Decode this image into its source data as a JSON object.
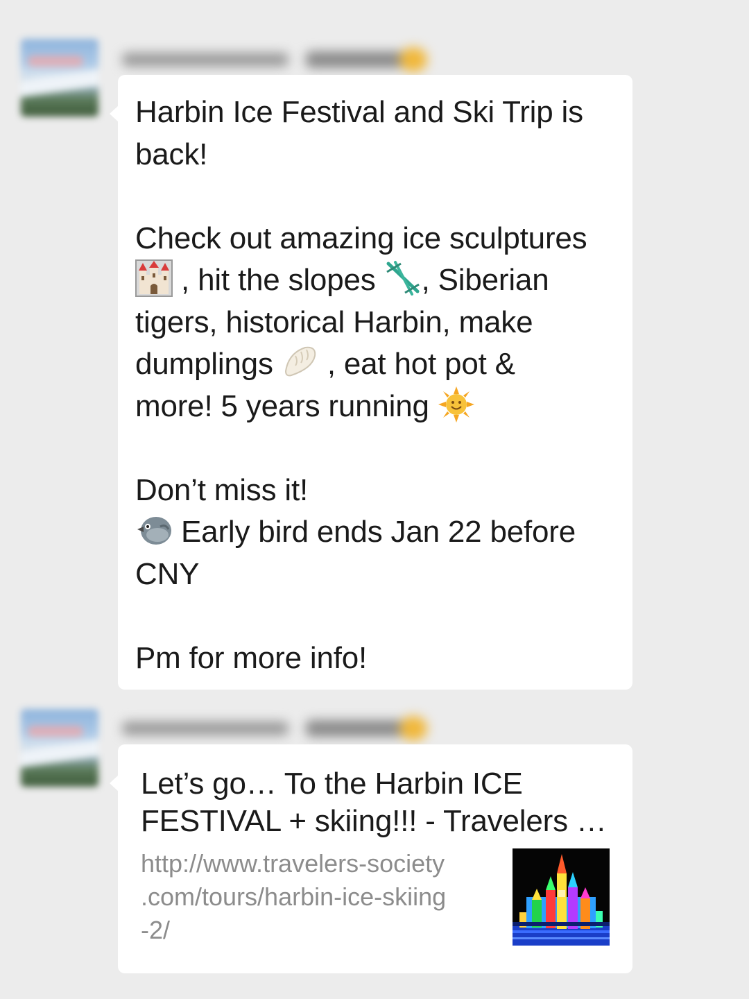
{
  "messages": [
    {
      "sender_avatar": "blurred-landscape-avatar",
      "sender_name_blurred": true,
      "text_paragraphs": {
        "p1_line1": "Harbin Ice Festival and Ski Trip is",
        "p1_line2": "back!",
        "p2_line1": "Check out amazing ice sculptures",
        "p2_line2_after_castle": " , hit the slopes ",
        "p2_line2_after_ski": ", Siberian",
        "p2_line3": "tigers, historical Harbin, make",
        "p2_line4_before_dumpling": "dumplings ",
        "p2_line4_after_dumpling": " , eat hot pot &",
        "p2_line5": "more! 5 years running ",
        "p3_line1": "Don’t miss it!",
        "p3_line2_after_bird": " Early bird ends Jan 22 before",
        "p3_line3": "CNY",
        "p4_line1": "Pm for more info!"
      },
      "emojis": [
        "castle-icon",
        "ski-icon",
        "dumpling-icon",
        "sun-icon",
        "bird-icon"
      ]
    },
    {
      "sender_avatar": "blurred-landscape-avatar",
      "sender_name_blurred": true,
      "link_card": {
        "title_line1": "Let’s go… To the Harbin ICE",
        "title_line2": "FESTIVAL + skiing!!! - Travelers …",
        "url_line1": "http://www.travelers-society",
        "url_line2": ".com/tours/harbin-ice-skiing",
        "url_line3": "-2/",
        "thumbnail": "ice-castle-thumbnail"
      }
    }
  ],
  "colors": {
    "background": "#ececec",
    "bubble": "#ffffff",
    "text": "#1a1a1a",
    "url_text": "#8c8c8c"
  }
}
